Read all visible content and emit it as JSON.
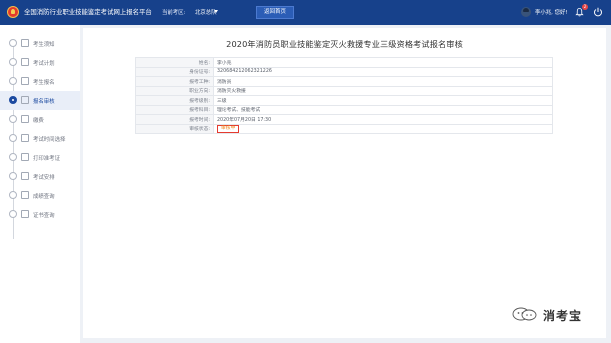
{
  "header": {
    "title": "全国消防行业职业技能鉴定考试网上报名平台",
    "region_label": "当前考区:",
    "region_value": "北京总队",
    "home_button": "返回首页",
    "user_greeting": "李小兆, 您好!",
    "notification_count": "2"
  },
  "sidebar": {
    "items": [
      {
        "label": "考生须知",
        "state": "done"
      },
      {
        "label": "考试计划",
        "state": "done"
      },
      {
        "label": "考生报名",
        "state": "done"
      },
      {
        "label": "报名审核",
        "state": "current"
      },
      {
        "label": "缴费",
        "state": "pending"
      },
      {
        "label": "考试时间选择",
        "state": "pending"
      },
      {
        "label": "打印准考证",
        "state": "pending"
      },
      {
        "label": "考试安排",
        "state": "pending"
      },
      {
        "label": "成绩查询",
        "state": "pending"
      },
      {
        "label": "证书查询",
        "state": "pending"
      }
    ]
  },
  "main": {
    "title": "2020年消防员职业技能鉴定灭火救援专业三级资格考试报名审核",
    "rows": [
      {
        "label": "姓名:",
        "value": "李小兆"
      },
      {
        "label": "身份证号:",
        "value": "320684212062321226"
      },
      {
        "label": "报考工种:",
        "value": "消防员"
      },
      {
        "label": "职业方向:",
        "value": "消防灭火救援"
      },
      {
        "label": "报考级别:",
        "value": "三级"
      },
      {
        "label": "报考科目:",
        "value": "理论考试、技能考试"
      },
      {
        "label": "报考时间:",
        "value": "2020年07月20日 17:30"
      },
      {
        "label": "审核状态:",
        "value": "审核中"
      }
    ]
  },
  "watermark": {
    "text": "消考宝"
  }
}
